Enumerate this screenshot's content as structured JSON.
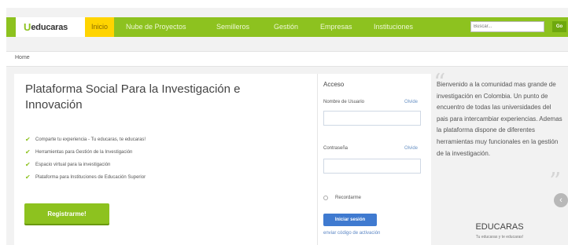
{
  "logo": {
    "mark": "U",
    "name": "educaras"
  },
  "nav": {
    "items": [
      {
        "label": "Inicio",
        "active": true
      },
      {
        "label": "Nube de Proyectos",
        "active": false
      },
      {
        "label": "Semilleros",
        "active": false
      },
      {
        "label": "Gestión",
        "active": false
      },
      {
        "label": "Empresas",
        "active": false
      },
      {
        "label": "Instituciones",
        "active": false
      }
    ],
    "search_placeholder": "Buscar...",
    "go_label": "Go"
  },
  "breadcrumb": {
    "home": "Home"
  },
  "hero": {
    "title": "Plataforma Social Para la Investigación e Innovación",
    "features": [
      "Comparte tu experiencia - Tu educaras, te educaras!",
      "Herramientas para Gestión de la Investigación",
      "Espacio virtual para la investigación",
      "Plataforma para Instituciones de Educación Superior"
    ],
    "register_label": "Registrarme!"
  },
  "login": {
    "title": "Acceso",
    "username_label": "Nombre de Usuario",
    "username_forgot": "Olvide",
    "password_label": "Contraseña",
    "password_forgot": "Olvide",
    "remember_label": "Recordarme",
    "submit_label": "Iniciar sesión",
    "activation_link": "enviar código de activación"
  },
  "sidebar": {
    "welcome": "Bienvenido a la comunidad mas grande de investigación en Colombia. Un punto de encuentro de todas las universidades del pais para intercambiar experiencias. Ademas la plataforma dispone de diferentes herramientas muy funcionales en la gestión de la investigación.",
    "brand_title": "EDUCARAS",
    "brand_tagline": "Tu educaras y te educaras!"
  },
  "colors": {
    "brand_green": "#8dc21f",
    "active_yellow": "#ffd400",
    "link_blue": "#3f7ad0"
  },
  "icons": {
    "feature": "check-icon",
    "scroll": "chevron-left-icon"
  }
}
